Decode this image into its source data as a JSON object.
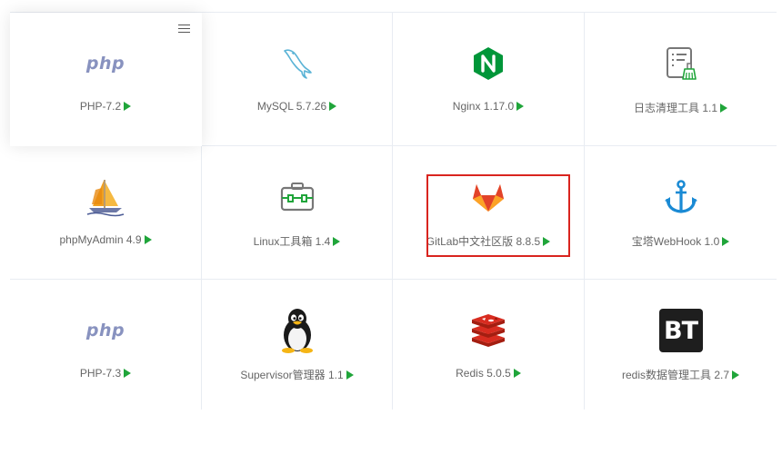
{
  "software": [
    {
      "name": "PHP-7.2",
      "icon": "php-icon"
    },
    {
      "name": "MySQL 5.7.26",
      "icon": "mysql-dolphin-icon"
    },
    {
      "name": "Nginx 1.17.0",
      "icon": "nginx-icon"
    },
    {
      "name": "日志清理工具 1.1",
      "icon": "log-cleaner-icon"
    },
    {
      "name": "phpMyAdmin 4.9",
      "icon": "phpmyadmin-sailboat-icon"
    },
    {
      "name": "Linux工具箱 1.4",
      "icon": "toolbox-icon"
    },
    {
      "name": "GitLab中文社区版 8.8.5",
      "icon": "gitlab-fox-icon"
    },
    {
      "name": "宝塔WebHook 1.0",
      "icon": "anchor-icon"
    },
    {
      "name": "PHP-7.3",
      "icon": "php-icon"
    },
    {
      "name": "Supervisor管理器 1.1",
      "icon": "linux-penguin-icon"
    },
    {
      "name": "Redis 5.0.5",
      "icon": "redis-icon"
    },
    {
      "name": "redis数据管理工具 2.7",
      "icon": "bt-icon"
    }
  ],
  "icon_text": {
    "php": "php",
    "bt": "BT"
  },
  "colors": {
    "run_arrow": "#20a53a",
    "highlight_border": "#d9241f",
    "nginx_green": "#009639",
    "php_purple": "#8892bf",
    "redis_red": "#d82c20",
    "anchor_blue": "#1a8ad4"
  },
  "highlighted_item": "GitLab中文社区版 8.8.5"
}
